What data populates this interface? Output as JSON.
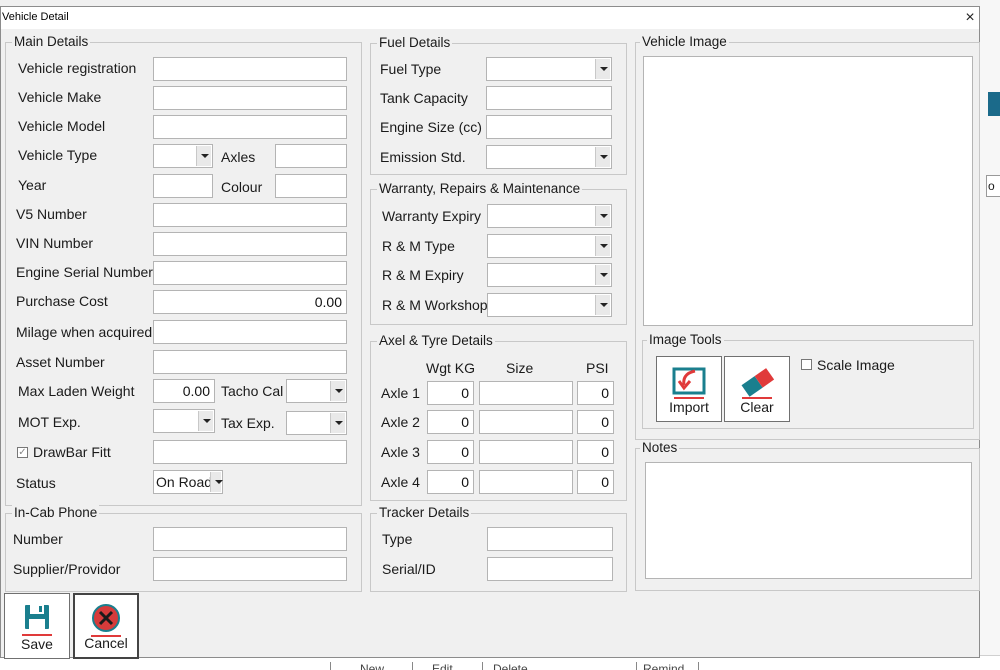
{
  "dialog": {
    "title": "Vehicle Detail",
    "close_glyph": "×"
  },
  "main_details": {
    "legend": "Main Details",
    "vehicle_registration": {
      "label": "Vehicle registration",
      "value": ""
    },
    "vehicle_make": {
      "label": "Vehicle Make",
      "value": ""
    },
    "vehicle_model": {
      "label": "Vehicle Model",
      "value": ""
    },
    "vehicle_type": {
      "label": "Vehicle Type",
      "value": ""
    },
    "axles": {
      "label": "Axles",
      "value": ""
    },
    "year": {
      "label": "Year",
      "value": ""
    },
    "colour": {
      "label": "Colour",
      "value": ""
    },
    "v5_number": {
      "label": "V5 Number",
      "value": ""
    },
    "vin_number": {
      "label": "VIN Number",
      "value": ""
    },
    "engine_serial": {
      "label": "Engine Serial Number",
      "value": ""
    },
    "purchase_cost": {
      "label": "Purchase Cost",
      "value": "0.00"
    },
    "milage_acquired": {
      "label": "Milage when acquired",
      "value": ""
    },
    "asset_number": {
      "label": "Asset Number",
      "value": ""
    },
    "max_laden_weight": {
      "label": "Max Laden Weight",
      "value": "0.00"
    },
    "tacho_cal": {
      "label": "Tacho Cal",
      "value": ""
    },
    "mot_exp": {
      "label": "MOT Exp.",
      "value": ""
    },
    "tax_exp": {
      "label": "Tax Exp.",
      "value": ""
    },
    "drawbar": {
      "label": "DrawBar Fitt",
      "checked": true,
      "value": ""
    },
    "status": {
      "label": "Status",
      "value": "On Road"
    }
  },
  "in_cab_phone": {
    "legend": "In-Cab Phone",
    "number": {
      "label": "Number",
      "value": ""
    },
    "supplier": {
      "label": "Supplier/Providor",
      "value": ""
    }
  },
  "fuel_details": {
    "legend": "Fuel Details",
    "fuel_type": {
      "label": "Fuel Type",
      "value": ""
    },
    "tank_capacity": {
      "label": "Tank Capacity",
      "value": ""
    },
    "engine_size": {
      "label": "Engine Size (cc)",
      "value": ""
    },
    "emission_std": {
      "label": "Emission Std.",
      "value": ""
    }
  },
  "warranty": {
    "legend": "Warranty, Repairs & Maintenance",
    "warranty_expiry": {
      "label": "Warranty Expiry",
      "value": ""
    },
    "rm_type": {
      "label": "R & M Type",
      "value": ""
    },
    "rm_expiry": {
      "label": "R & M Expiry",
      "value": ""
    },
    "rm_workshop": {
      "label": "R & M Workshop",
      "value": ""
    }
  },
  "axel_tyre": {
    "legend": "Axel & Tyre Details",
    "col_wgt": "Wgt KG",
    "col_size": "Size",
    "col_psi": "PSI",
    "rows": [
      {
        "label": "Axle 1",
        "wgt": "0",
        "size": "",
        "psi": "0"
      },
      {
        "label": "Axle 2",
        "wgt": "0",
        "size": "",
        "psi": "0"
      },
      {
        "label": "Axle 3",
        "wgt": "0",
        "size": "",
        "psi": "0"
      },
      {
        "label": "Axle 4",
        "wgt": "0",
        "size": "",
        "psi": "0"
      }
    ]
  },
  "tracker": {
    "legend": "Tracker Details",
    "type": {
      "label": "Type",
      "value": ""
    },
    "serial": {
      "label": "Serial/ID",
      "value": ""
    }
  },
  "vehicle_image": {
    "legend": "Vehicle Image"
  },
  "image_tools": {
    "legend": "Image Tools",
    "import_label": "Import",
    "clear_label": "Clear",
    "scale_label": "Scale Image",
    "scale_checked": false
  },
  "notes": {
    "legend": "Notes",
    "value": ""
  },
  "buttons": {
    "save_label": "Save",
    "cancel_label": "Cancel"
  },
  "background": {
    "right_fragment": "o",
    "bottom_items": [
      "New",
      "Edit",
      "Delete",
      "Remind"
    ]
  },
  "colors": {
    "accent_teal": "#1b6a8a",
    "cancel_red": "#d63b3b",
    "icon_teal": "#1a7f8e",
    "icon_red": "#e03a3a"
  },
  "icons": {
    "save": "floppy-disk-icon",
    "cancel": "red-x-circle-icon",
    "import": "import-arrow-icon",
    "clear": "eraser-icon"
  }
}
